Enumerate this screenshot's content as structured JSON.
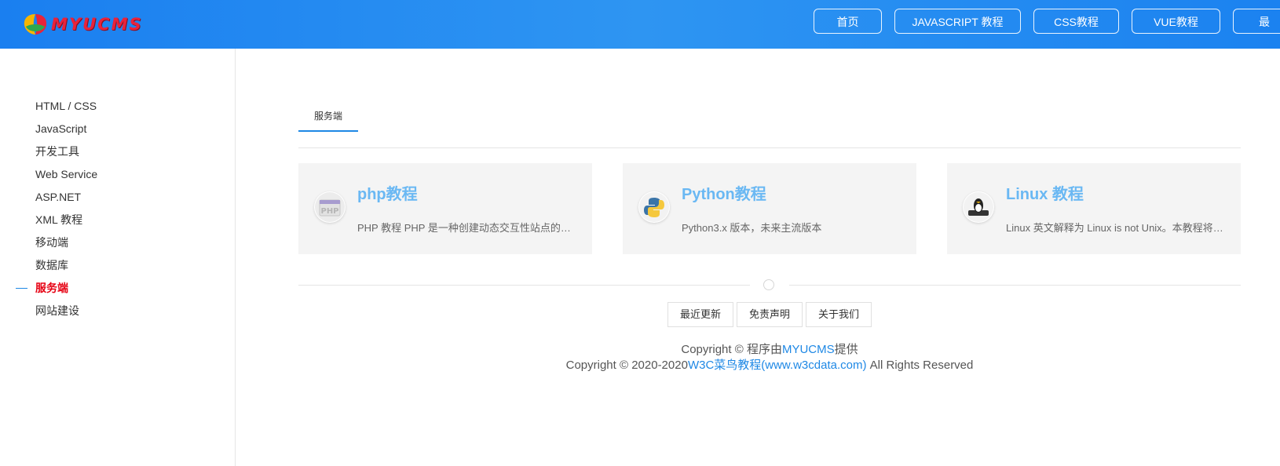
{
  "header": {
    "logo_text": "MYUCMS",
    "nav": [
      {
        "label": "首页"
      },
      {
        "label": "JAVASCRIPT 教程"
      },
      {
        "label": "CSS教程"
      },
      {
        "label": "VUE教程"
      },
      {
        "label": "最"
      }
    ]
  },
  "sidebar": {
    "items": [
      {
        "label": "HTML / CSS"
      },
      {
        "label": "JavaScript"
      },
      {
        "label": "开发工具"
      },
      {
        "label": "Web Service"
      },
      {
        "label": "ASP.NET"
      },
      {
        "label": "XML 教程"
      },
      {
        "label": "移动端"
      },
      {
        "label": "数据库"
      },
      {
        "label": "服务端"
      },
      {
        "label": "网站建设"
      }
    ],
    "active_index": 8
  },
  "main": {
    "tab": "服务端",
    "cards": [
      {
        "title": "php教程",
        "desc": "PHP 教程 PHP 是一种创建动态交互性站点的强有力的服务器端脚本语言。",
        "icon": "php-icon"
      },
      {
        "title": "Python教程",
        "desc": "Python3.x 版本，未来主流版本",
        "icon": "python-icon"
      },
      {
        "title": "Linux 教程",
        "desc": "Linux 英文解释为 Linux is not Unix。本教程将介绍Linux的基本知识。",
        "icon": "linux-icon"
      }
    ]
  },
  "footer": {
    "links": [
      {
        "label": "最近更新"
      },
      {
        "label": "免责声明"
      },
      {
        "label": "关于我们"
      }
    ],
    "copy1_prefix": "Copyright © 程序由",
    "copy1_link": "MYUCMS",
    "copy1_suffix": "提供",
    "copy2_prefix": "Copyright © 2020-2020",
    "copy2_link": "W3C菜鸟教程(www.w3cdata.com)",
    "copy2_suffix": " All Rights Reserved"
  },
  "colors": {
    "header_bg": "#1e88f0",
    "active": "#e60012",
    "accent": "#1e88e5",
    "card_title": "#6ab8f3",
    "logo": "#e8233b"
  }
}
